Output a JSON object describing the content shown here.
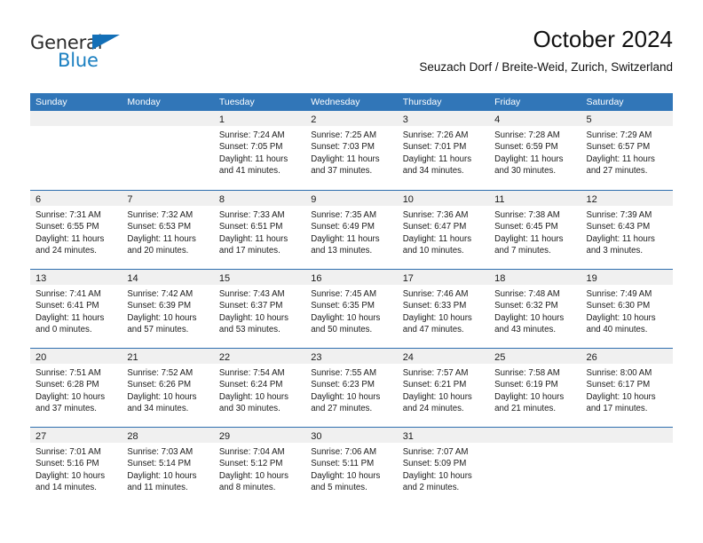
{
  "brand": {
    "name_part1": "General",
    "name_part2": "Blue",
    "accent_color": "#1a7fc1",
    "triangle_color": "#136fb7"
  },
  "header": {
    "title": "October 2024",
    "subtitle": "Seuzach Dorf / Breite-Weid, Zurich, Switzerland"
  },
  "calendar": {
    "header_bg": "#3176b8",
    "day_band_bg": "#f0f0f0",
    "weekdays": [
      "Sunday",
      "Monday",
      "Tuesday",
      "Wednesday",
      "Thursday",
      "Friday",
      "Saturday"
    ],
    "weeks": [
      [
        {
          "day": "",
          "lines": []
        },
        {
          "day": "",
          "lines": []
        },
        {
          "day": "1",
          "lines": [
            "Sunrise: 7:24 AM",
            "Sunset: 7:05 PM",
            "Daylight: 11 hours",
            "and 41 minutes."
          ]
        },
        {
          "day": "2",
          "lines": [
            "Sunrise: 7:25 AM",
            "Sunset: 7:03 PM",
            "Daylight: 11 hours",
            "and 37 minutes."
          ]
        },
        {
          "day": "3",
          "lines": [
            "Sunrise: 7:26 AM",
            "Sunset: 7:01 PM",
            "Daylight: 11 hours",
            "and 34 minutes."
          ]
        },
        {
          "day": "4",
          "lines": [
            "Sunrise: 7:28 AM",
            "Sunset: 6:59 PM",
            "Daylight: 11 hours",
            "and 30 minutes."
          ]
        },
        {
          "day": "5",
          "lines": [
            "Sunrise: 7:29 AM",
            "Sunset: 6:57 PM",
            "Daylight: 11 hours",
            "and 27 minutes."
          ]
        }
      ],
      [
        {
          "day": "6",
          "lines": [
            "Sunrise: 7:31 AM",
            "Sunset: 6:55 PM",
            "Daylight: 11 hours",
            "and 24 minutes."
          ]
        },
        {
          "day": "7",
          "lines": [
            "Sunrise: 7:32 AM",
            "Sunset: 6:53 PM",
            "Daylight: 11 hours",
            "and 20 minutes."
          ]
        },
        {
          "day": "8",
          "lines": [
            "Sunrise: 7:33 AM",
            "Sunset: 6:51 PM",
            "Daylight: 11 hours",
            "and 17 minutes."
          ]
        },
        {
          "day": "9",
          "lines": [
            "Sunrise: 7:35 AM",
            "Sunset: 6:49 PM",
            "Daylight: 11 hours",
            "and 13 minutes."
          ]
        },
        {
          "day": "10",
          "lines": [
            "Sunrise: 7:36 AM",
            "Sunset: 6:47 PM",
            "Daylight: 11 hours",
            "and 10 minutes."
          ]
        },
        {
          "day": "11",
          "lines": [
            "Sunrise: 7:38 AM",
            "Sunset: 6:45 PM",
            "Daylight: 11 hours",
            "and 7 minutes."
          ]
        },
        {
          "day": "12",
          "lines": [
            "Sunrise: 7:39 AM",
            "Sunset: 6:43 PM",
            "Daylight: 11 hours",
            "and 3 minutes."
          ]
        }
      ],
      [
        {
          "day": "13",
          "lines": [
            "Sunrise: 7:41 AM",
            "Sunset: 6:41 PM",
            "Daylight: 11 hours",
            "and 0 minutes."
          ]
        },
        {
          "day": "14",
          "lines": [
            "Sunrise: 7:42 AM",
            "Sunset: 6:39 PM",
            "Daylight: 10 hours",
            "and 57 minutes."
          ]
        },
        {
          "day": "15",
          "lines": [
            "Sunrise: 7:43 AM",
            "Sunset: 6:37 PM",
            "Daylight: 10 hours",
            "and 53 minutes."
          ]
        },
        {
          "day": "16",
          "lines": [
            "Sunrise: 7:45 AM",
            "Sunset: 6:35 PM",
            "Daylight: 10 hours",
            "and 50 minutes."
          ]
        },
        {
          "day": "17",
          "lines": [
            "Sunrise: 7:46 AM",
            "Sunset: 6:33 PM",
            "Daylight: 10 hours",
            "and 47 minutes."
          ]
        },
        {
          "day": "18",
          "lines": [
            "Sunrise: 7:48 AM",
            "Sunset: 6:32 PM",
            "Daylight: 10 hours",
            "and 43 minutes."
          ]
        },
        {
          "day": "19",
          "lines": [
            "Sunrise: 7:49 AM",
            "Sunset: 6:30 PM",
            "Daylight: 10 hours",
            "and 40 minutes."
          ]
        }
      ],
      [
        {
          "day": "20",
          "lines": [
            "Sunrise: 7:51 AM",
            "Sunset: 6:28 PM",
            "Daylight: 10 hours",
            "and 37 minutes."
          ]
        },
        {
          "day": "21",
          "lines": [
            "Sunrise: 7:52 AM",
            "Sunset: 6:26 PM",
            "Daylight: 10 hours",
            "and 34 minutes."
          ]
        },
        {
          "day": "22",
          "lines": [
            "Sunrise: 7:54 AM",
            "Sunset: 6:24 PM",
            "Daylight: 10 hours",
            "and 30 minutes."
          ]
        },
        {
          "day": "23",
          "lines": [
            "Sunrise: 7:55 AM",
            "Sunset: 6:23 PM",
            "Daylight: 10 hours",
            "and 27 minutes."
          ]
        },
        {
          "day": "24",
          "lines": [
            "Sunrise: 7:57 AM",
            "Sunset: 6:21 PM",
            "Daylight: 10 hours",
            "and 24 minutes."
          ]
        },
        {
          "day": "25",
          "lines": [
            "Sunrise: 7:58 AM",
            "Sunset: 6:19 PM",
            "Daylight: 10 hours",
            "and 21 minutes."
          ]
        },
        {
          "day": "26",
          "lines": [
            "Sunrise: 8:00 AM",
            "Sunset: 6:17 PM",
            "Daylight: 10 hours",
            "and 17 minutes."
          ]
        }
      ],
      [
        {
          "day": "27",
          "lines": [
            "Sunrise: 7:01 AM",
            "Sunset: 5:16 PM",
            "Daylight: 10 hours",
            "and 14 minutes."
          ]
        },
        {
          "day": "28",
          "lines": [
            "Sunrise: 7:03 AM",
            "Sunset: 5:14 PM",
            "Daylight: 10 hours",
            "and 11 minutes."
          ]
        },
        {
          "day": "29",
          "lines": [
            "Sunrise: 7:04 AM",
            "Sunset: 5:12 PM",
            "Daylight: 10 hours",
            "and 8 minutes."
          ]
        },
        {
          "day": "30",
          "lines": [
            "Sunrise: 7:06 AM",
            "Sunset: 5:11 PM",
            "Daylight: 10 hours",
            "and 5 minutes."
          ]
        },
        {
          "day": "31",
          "lines": [
            "Sunrise: 7:07 AM",
            "Sunset: 5:09 PM",
            "Daylight: 10 hours",
            "and 2 minutes."
          ]
        },
        {
          "day": "",
          "lines": []
        },
        {
          "day": "",
          "lines": []
        }
      ]
    ]
  }
}
